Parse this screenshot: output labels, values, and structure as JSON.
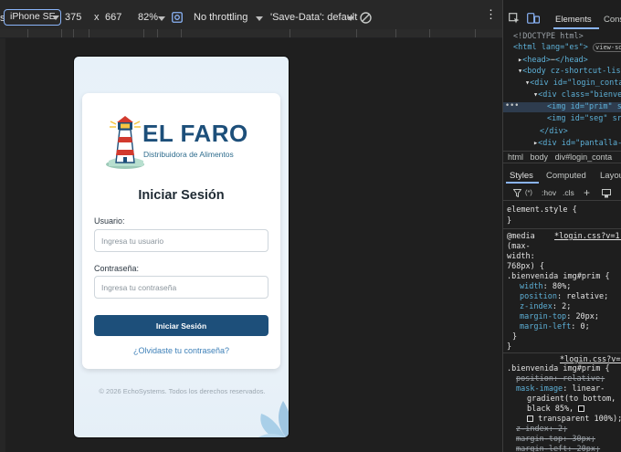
{
  "toolbar": {
    "left_fragment": "s",
    "device": "iPhone SE",
    "width": "375",
    "times": "x",
    "height": "667",
    "zoom": "82%",
    "throttling": "No throttling",
    "save_data": "'Save-Data': default"
  },
  "page": {
    "brand_title": "EL FARO",
    "brand_subtitle": "Distribuidora de Alimentos",
    "login_title": "Iniciar Sesión",
    "username_label": "Usuario:",
    "username_placeholder": "Ingresa tu usuario",
    "password_label": "Contraseña:",
    "password_placeholder": "Ingresa tu contraseña",
    "login_button": "Iniciar Sesión",
    "forgot_link": "¿Olvidaste tu contraseña?",
    "footer": "© 2026 EchoSystems. Todos los derechos reservados."
  },
  "devtools": {
    "tabs": [
      "Elements",
      "Cons"
    ],
    "dom": [
      "<!DOCTYPE html>",
      "<html lang=\"es\">",
      "<head>",
      "</head>",
      "<body cz-shortcut-lis",
      "<div id=\"login_conta",
      "<div class=\"bienve",
      "<img id=\"prim\" s",
      "<img id=\"seg\" src",
      "</div>",
      "<div id=\"pantalla-"
    ],
    "view_source_badge": "view-sour",
    "breadcrumb": [
      "html",
      "body",
      "div#login_conta"
    ],
    "style_tabs": [
      "Styles",
      "Computed",
      "Layou"
    ],
    "filter": [
      ":hov",
      ".cls"
    ],
    "element_style": "element.style {",
    "element_style_close": "}",
    "media_lines": [
      "@media",
      "(max-",
      "width:",
      "768px) {"
    ],
    "rule1_link": "*login.css?v=1:",
    "rule1_selector": ".bienvenida img#prim {",
    "rule1_props": [
      {
        "p": "width",
        "v": "80%;"
      },
      {
        "p": "position",
        "v": "relative;"
      },
      {
        "p": "z-index",
        "v": "2;"
      },
      {
        "p": "margin-top",
        "v": "20px;"
      },
      {
        "p": "margin-left",
        "v": "0;"
      }
    ],
    "close_brace": "}",
    "rule2_link": "*login.css?v=3",
    "rule2_selector": ".bienvenida img#prim {",
    "rule2_position": "position: relative;",
    "rule2_mask_prop": "mask-image",
    "rule2_mask_value": [
      "linear-",
      "gradient(to bottom,",
      "black 85%,",
      "transparent 100%);"
    ],
    "rule2_zindex": "z-index: 2;",
    "rule2_margin_top": "margin-top: 30px;",
    "rule2_margin_left": "margin-left: 20px;"
  }
}
